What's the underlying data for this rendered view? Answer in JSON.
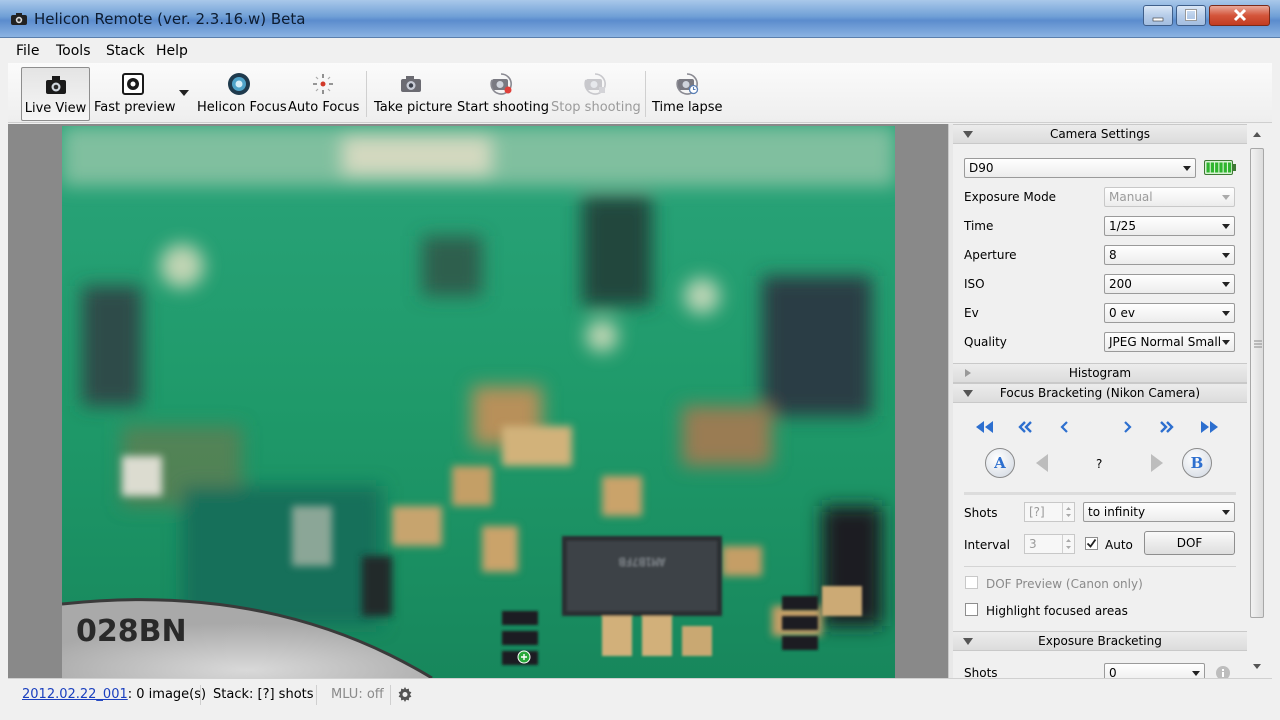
{
  "window": {
    "title": "Helicon Remote (ver. 2.3.16.w) Beta"
  },
  "menu": {
    "items": [
      "File",
      "Tools",
      "Stack",
      "Help"
    ]
  },
  "toolbar": {
    "live_view": "Live View",
    "fast_preview": "Fast preview",
    "helicon_focus": "Helicon Focus",
    "auto_focus": "Auto Focus",
    "take_picture": "Take picture",
    "start_shooting": "Start shooting",
    "stop_shooting": "Stop shooting",
    "time_lapse": "Time lapse"
  },
  "preview": {
    "image_text": "028BN"
  },
  "camera_settings": {
    "header": "Camera Settings",
    "camera": "D90",
    "exposure_mode_label": "Exposure Mode",
    "exposure_mode_value": "Manual",
    "time_label": "Time",
    "time_value": "1/25",
    "aperture_label": "Aperture",
    "aperture_value": "8",
    "iso_label": "ISO",
    "iso_value": "200",
    "ev_label": "Ev",
    "ev_value": "0 ev",
    "quality_label": "Quality",
    "quality_value": "JPEG Normal Small",
    "battery_level": 1.0
  },
  "histogram": {
    "header": "Histogram"
  },
  "focus_bracketing": {
    "header": "Focus Bracketing (Nikon Camera)",
    "point_a": "A",
    "point_b": "B",
    "position": "?",
    "shots_label": "Shots",
    "shots_value": "[?]",
    "shots_mode": "to infinity",
    "interval_label": "Interval",
    "interval_value": "3",
    "auto_label": "Auto",
    "auto_checked": true,
    "dof_button": "DOF",
    "dof_preview_label": "DOF Preview (Canon only)",
    "highlight_label": "Highlight focused areas"
  },
  "exposure_bracketing": {
    "header": "Exposure Bracketing",
    "shots_label": "Shots",
    "shots_value": "0"
  },
  "status": {
    "folder_link": "2012.02.22_001",
    "image_count": ": 0 image(s)",
    "stack": "Stack: [?] shots",
    "mlu": "MLU: off"
  },
  "colors": {
    "accent_blue": "#2d6fcf",
    "link_blue": "#1a3fbf",
    "battery_green": "#2fb52f",
    "pcb_green": "#1f9a6a"
  }
}
